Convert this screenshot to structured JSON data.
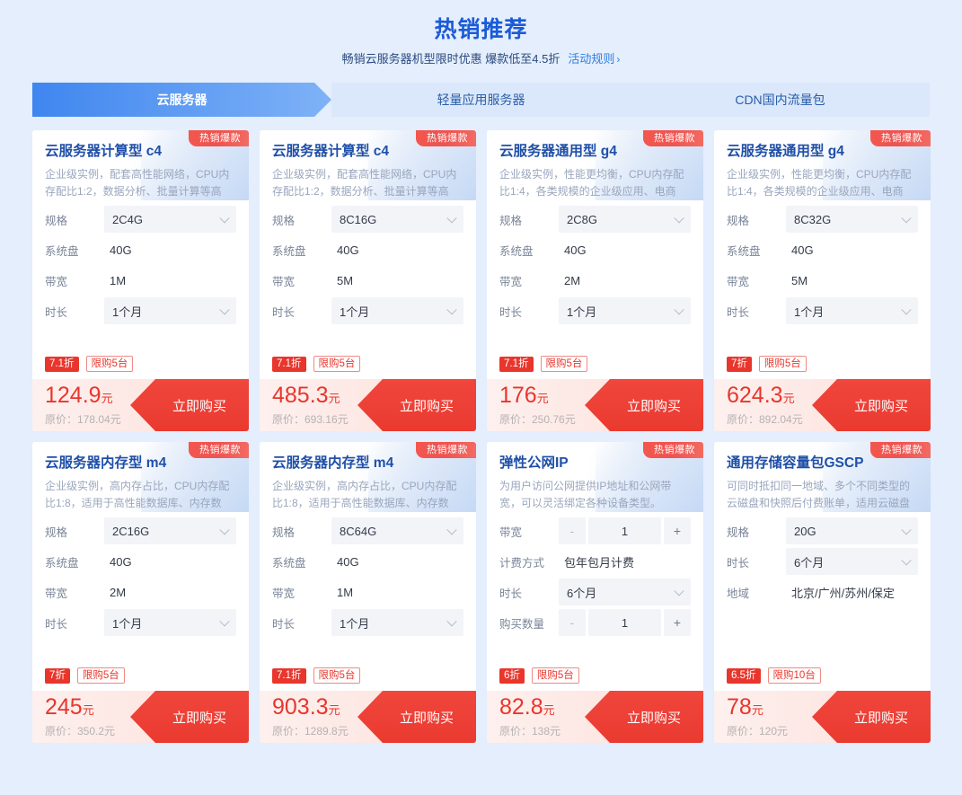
{
  "header": {
    "title": "热销推荐",
    "subtitle": "畅销云服务器机型限时优惠 爆款低至4.5折",
    "rule_link": "活动规则",
    "chevron": "›"
  },
  "tabs": [
    {
      "label": "云服务器",
      "active": true
    },
    {
      "label": "轻量应用服务器",
      "active": false
    },
    {
      "label": "CDN国内流量包",
      "active": false
    }
  ],
  "labels": {
    "badge": "热销爆款",
    "buy": "立即购买",
    "price_prefix": "原价：",
    "yuan": "元",
    "minus": "-",
    "plus": "+"
  },
  "colors": {
    "brand_blue": "#1b5bd7",
    "tab_active_from": "#3f86ef",
    "tab_active_to": "#7fb2f7",
    "accent_red": "#e8362c",
    "page_bg": "#e4eefc",
    "card_bg": "#ffffff"
  },
  "cards": [
    {
      "badge": "热销爆款",
      "title": "云服务器计算型 c4",
      "desc": "企业级实例，配套高性能网络，CPU内存配比1:2，数据分析、批量计算等高",
      "specs": [
        {
          "label": "规格",
          "value": "2C4G",
          "type": "select"
        },
        {
          "label": "系统盘",
          "value": "40G",
          "type": "text"
        },
        {
          "label": "带宽",
          "value": "1M",
          "type": "text"
        },
        {
          "label": "时长",
          "value": "1个月",
          "type": "select"
        }
      ],
      "discount": "7.1折",
      "limit": "限购5台",
      "price": "124.9",
      "unit": "元",
      "original": "原价：178.04元",
      "buy": "立即购买"
    },
    {
      "badge": "热销爆款",
      "title": "云服务器计算型 c4",
      "desc": "企业级实例，配套高性能网络，CPU内存配比1:2，数据分析、批量计算等高",
      "specs": [
        {
          "label": "规格",
          "value": "8C16G",
          "type": "select"
        },
        {
          "label": "系统盘",
          "value": "40G",
          "type": "text"
        },
        {
          "label": "带宽",
          "value": "5M",
          "type": "text"
        },
        {
          "label": "时长",
          "value": "1个月",
          "type": "select"
        }
      ],
      "discount": "7.1折",
      "limit": "限购5台",
      "price": "485.3",
      "unit": "元",
      "original": "原价：693.16元",
      "buy": "立即购买"
    },
    {
      "badge": "热销爆款",
      "title": "云服务器通用型 g4",
      "desc": "企业级实例，性能更均衡，CPU内存配比1:4，各类规模的企业级应用、电商",
      "specs": [
        {
          "label": "规格",
          "value": "2C8G",
          "type": "select"
        },
        {
          "label": "系统盘",
          "value": "40G",
          "type": "text"
        },
        {
          "label": "带宽",
          "value": "2M",
          "type": "text"
        },
        {
          "label": "时长",
          "value": "1个月",
          "type": "select"
        }
      ],
      "discount": "7.1折",
      "limit": "限购5台",
      "price": "176",
      "unit": "元",
      "original": "原价：250.76元",
      "buy": "立即购买"
    },
    {
      "badge": "热销爆款",
      "title": "云服务器通用型 g4",
      "desc": "企业级实例，性能更均衡，CPU内存配比1:4，各类规模的企业级应用、电商",
      "specs": [
        {
          "label": "规格",
          "value": "8C32G",
          "type": "select"
        },
        {
          "label": "系统盘",
          "value": "40G",
          "type": "text"
        },
        {
          "label": "带宽",
          "value": "5M",
          "type": "text"
        },
        {
          "label": "时长",
          "value": "1个月",
          "type": "select"
        }
      ],
      "discount": "7折",
      "limit": "限购5台",
      "price": "624.3",
      "unit": "元",
      "original": "原价：892.04元",
      "buy": "立即购买"
    },
    {
      "badge": "热销爆款",
      "title": "云服务器内存型 m4",
      "desc": "企业级实例，高内存占比，CPU内存配比1:8，适用于高性能数据库、内存数",
      "specs": [
        {
          "label": "规格",
          "value": "2C16G",
          "type": "select"
        },
        {
          "label": "系统盘",
          "value": "40G",
          "type": "text"
        },
        {
          "label": "带宽",
          "value": "2M",
          "type": "text"
        },
        {
          "label": "时长",
          "value": "1个月",
          "type": "select"
        }
      ],
      "discount": "7折",
      "limit": "限购5台",
      "price": "245",
      "unit": "元",
      "original": "原价：350.2元",
      "buy": "立即购买"
    },
    {
      "badge": "热销爆款",
      "title": "云服务器内存型 m4",
      "desc": "企业级实例，高内存占比，CPU内存配比1:8，适用于高性能数据库、内存数",
      "specs": [
        {
          "label": "规格",
          "value": "8C64G",
          "type": "select"
        },
        {
          "label": "系统盘",
          "value": "40G",
          "type": "text"
        },
        {
          "label": "带宽",
          "value": "1M",
          "type": "text"
        },
        {
          "label": "时长",
          "value": "1个月",
          "type": "select"
        }
      ],
      "discount": "7.1折",
      "limit": "限购5台",
      "price": "903.3",
      "unit": "元",
      "original": "原价：1289.8元",
      "buy": "立即购买"
    },
    {
      "badge": "热销爆款",
      "title": "弹性公网IP",
      "desc": "为用户访问公网提供IP地址和公网带宽，可以灵活绑定各种设备类型。",
      "specs": [
        {
          "label": "带宽",
          "value": "1",
          "type": "stepper"
        },
        {
          "label": "计费方式",
          "value": "包年包月计费",
          "type": "text"
        },
        {
          "label": "时长",
          "value": "6个月",
          "type": "select"
        },
        {
          "label": "购买数量",
          "value": "1",
          "type": "stepper"
        }
      ],
      "discount": "6折",
      "limit": "限购5台",
      "price": "82.8",
      "unit": "元",
      "original": "原价：138元",
      "buy": "立即购买"
    },
    {
      "badge": "热销爆款",
      "title": "通用存储容量包GSCP",
      "desc": "可同时抵扣同一地域、多个不同类型的云磁盘和快照后付费账单，适用云磁盘",
      "specs": [
        {
          "label": "规格",
          "value": "20G",
          "type": "select"
        },
        {
          "label": "时长",
          "value": "6个月",
          "type": "select"
        },
        {
          "label": "地域",
          "value": "北京/广州/苏州/保定",
          "type": "text"
        }
      ],
      "discount": "6.5折",
      "limit": "限购10台",
      "price": "78",
      "unit": "元",
      "original": "原价：120元",
      "buy": "立即购买"
    }
  ]
}
